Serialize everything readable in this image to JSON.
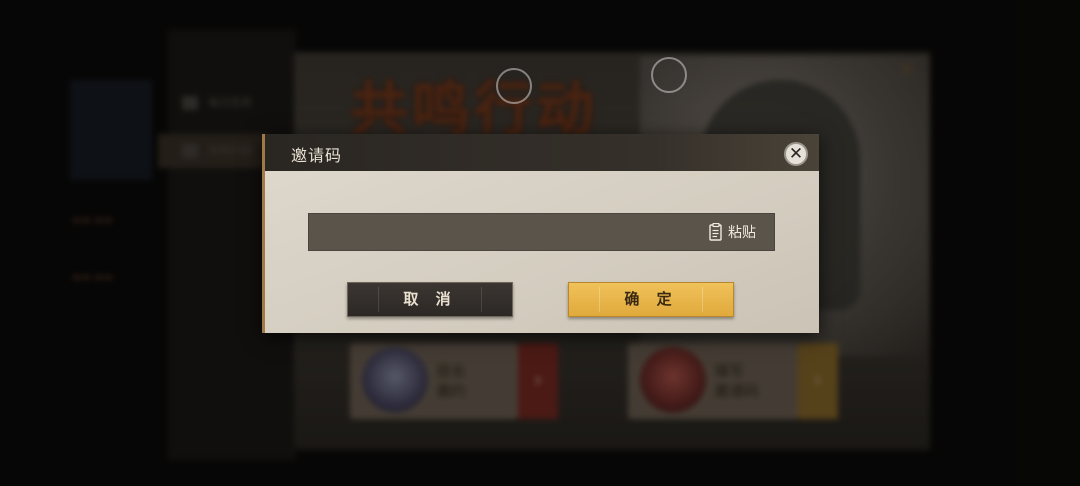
{
  "background": {
    "left_menu": [
      "每日签到",
      "共鸣行动"
    ],
    "banner_title": "共鸣行动",
    "cards": [
      {
        "label_line1": "班长",
        "label_line2": "邀约"
      },
      {
        "label_line1": "填写",
        "label_line2": "邀请码"
      }
    ]
  },
  "dialog": {
    "title": "邀请码",
    "close_symbol": "✕",
    "input": {
      "value": "",
      "placeholder": ""
    },
    "paste_label": "粘贴",
    "cancel_label": "取 消",
    "confirm_label": "确 定"
  },
  "colors": {
    "confirm": "#e8b44a",
    "cancel": "#332e2a",
    "header": "#2f2a25",
    "body": "#d6cfc3",
    "accent": "#a07a46"
  }
}
